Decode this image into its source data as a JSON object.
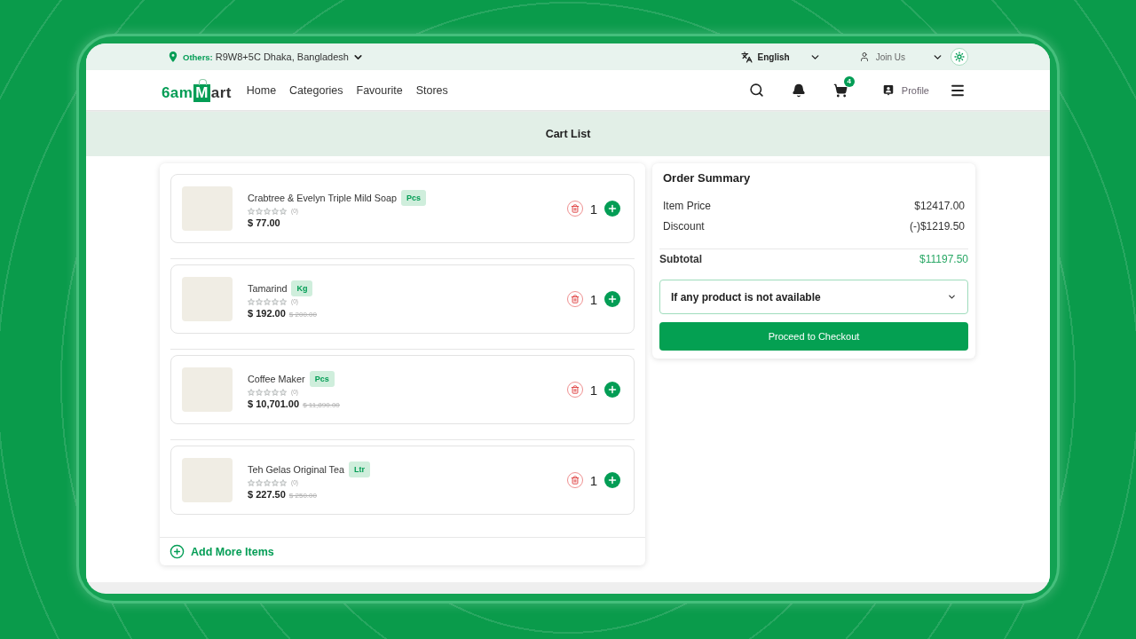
{
  "top_bar": {
    "location_label": "Others:",
    "location": "R9W8+5C Dhaka, Bangladesh",
    "language": "English",
    "account": "Join Us"
  },
  "header": {
    "logo": {
      "start": "6am",
      "mark": "M",
      "end": "art"
    },
    "nav": [
      {
        "label": "Home",
        "selected": false
      },
      {
        "label": "Categories",
        "selected": false
      },
      {
        "label": "Favourite",
        "selected": false
      },
      {
        "label": "Stores",
        "selected": false
      }
    ],
    "cart_count": "4",
    "profile": "Profile"
  },
  "page_title": "Cart List",
  "cart": {
    "items": [
      {
        "name": "Crabtree & Evelyn Triple Mild Soap",
        "unit": "Pcs",
        "stars": 0,
        "reviews": "(0)",
        "price": "$ 77.00",
        "quantity": "1"
      },
      {
        "name": "Tamarind",
        "unit": "Kg",
        "stars": 0,
        "reviews": "(0)",
        "price": "$ 192.00",
        "old_price": "$ 200.00",
        "quantity": "1"
      },
      {
        "name": "Coffee Maker",
        "unit": "Pcs",
        "stars": 0,
        "reviews": "(0)",
        "price": "$ 10,701.00",
        "old_price": "$ 11,890.00",
        "quantity": "1"
      },
      {
        "name": "Teh Gelas Original Tea",
        "unit": "Ltr",
        "stars": 0,
        "reviews": "(0)",
        "price": "$ 227.50",
        "old_price": "$ 250.00",
        "quantity": "1"
      }
    ],
    "add_more": "Add More Items"
  },
  "order_summary": {
    "title": "Order Summary",
    "rows": [
      {
        "label": "Item Price",
        "value": "$12417.00"
      },
      {
        "label": "Discount",
        "value": "(-)$1219.50"
      }
    ],
    "subtotal": {
      "label": "Subtotal",
      "value": "$11197.50"
    },
    "unavailable_select": {
      "value": "If any product is not available"
    },
    "checkout_button": "Proceed to Checkout"
  }
}
